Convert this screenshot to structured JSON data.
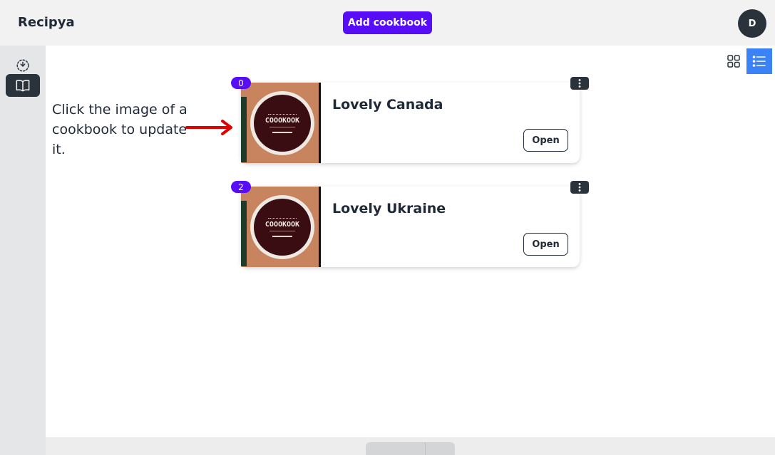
{
  "header": {
    "app_name": "Recipya",
    "add_button_label": "Add cookbook",
    "avatar_initial": "D"
  },
  "sidebar": {
    "items": [
      {
        "icon": "select-dashed-icon"
      },
      {
        "icon": "open-book-icon",
        "active": true
      }
    ]
  },
  "view_toggle": {
    "grid_icon": "grid-view-icon",
    "list_icon": "list-view-icon",
    "active": "list"
  },
  "hint": {
    "text": "Click the image of a cookbook to update it.",
    "arrow_icon": "arrow-right-icon"
  },
  "cookbooks": [
    {
      "index": "0",
      "title": "Lovely Canada",
      "cover_text": "COOOKOOK",
      "open_label": "Open",
      "menu_icon": "kebab-menu-icon"
    },
    {
      "index": "2",
      "title": "Lovely Ukraine",
      "cover_text": "COOOKOOK",
      "open_label": "Open",
      "menu_icon": "kebab-menu-icon"
    }
  ],
  "colors": {
    "primary": "#570df8",
    "dark": "#2a323c",
    "active_view": "#3b82f6",
    "arrow": "#e00000"
  }
}
